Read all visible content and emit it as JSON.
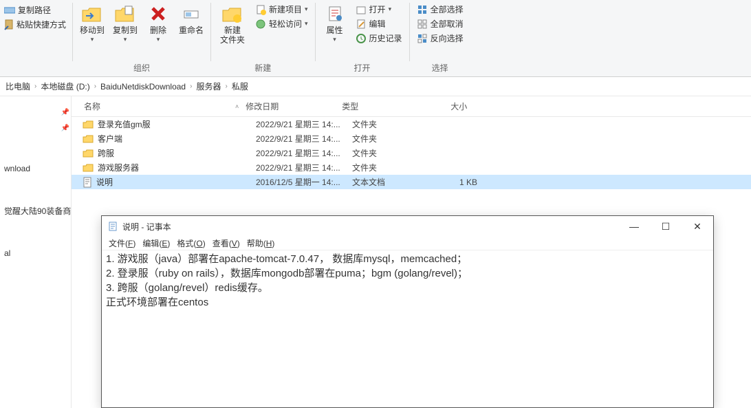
{
  "ribbon": {
    "left": {
      "copy_path": "复制路径",
      "paste_shortcut": "粘贴快捷方式"
    },
    "organize": {
      "move_to": "移动到",
      "copy_to": "复制到",
      "delete": "删除",
      "rename": "重命名",
      "group_label": "组织"
    },
    "new": {
      "new_folder": "新建\n文件夹",
      "new_item": "新建项目",
      "easy_access": "轻松访问",
      "group_label": "新建"
    },
    "open": {
      "properties": "属性",
      "open": "打开",
      "edit": "编辑",
      "history": "历史记录",
      "group_label": "打开"
    },
    "select": {
      "select_all": "全部选择",
      "select_none": "全部取消",
      "invert": "反向选择",
      "group_label": "选择"
    }
  },
  "breadcrumb": [
    "比电脑",
    "本地磁盘 (D:)",
    "BaiduNetdiskDownload",
    "服务器",
    "私服"
  ],
  "sidebar": {
    "item_download": "wnload",
    "item_equip": "觉醒大陆90装备商!",
    "item_al": "al"
  },
  "columns": {
    "name": "名称",
    "date": "修改日期",
    "type": "类型",
    "size": "大小"
  },
  "files": [
    {
      "name": "登录充值gm服",
      "date": "2022/9/21 星期三 14:...",
      "type": "文件夹",
      "size": "",
      "icon": "folder"
    },
    {
      "name": "客户端",
      "date": "2022/9/21 星期三 14:...",
      "type": "文件夹",
      "size": "",
      "icon": "folder"
    },
    {
      "name": "跨服",
      "date": "2022/9/21 星期三 14:...",
      "type": "文件夹",
      "size": "",
      "icon": "folder"
    },
    {
      "name": "游戏服务器",
      "date": "2022/9/21 星期三 14:...",
      "type": "文件夹",
      "size": "",
      "icon": "folder"
    },
    {
      "name": "说明",
      "date": "2016/12/5 星期一 14:...",
      "type": "文本文档",
      "size": "1 KB",
      "icon": "txt",
      "selected": true
    }
  ],
  "notepad": {
    "title": "说明 - 记事本",
    "menu": {
      "file": "文件(F)",
      "edit": "编辑(E)",
      "format": "格式(O)",
      "view": "查看(V)",
      "help": "帮助(H)"
    },
    "lines": [
      "1. 游戏服（java）部署在apache-tomcat-7.0.47， 数据库mysql，memcached；",
      "2. 登录服（ruby on rails），数据库mongodb部署在puma；bgm (golang/revel)；",
      "3. 跨服（golang/revel）redis缓存。",
      "正式环境部署在centos"
    ]
  }
}
